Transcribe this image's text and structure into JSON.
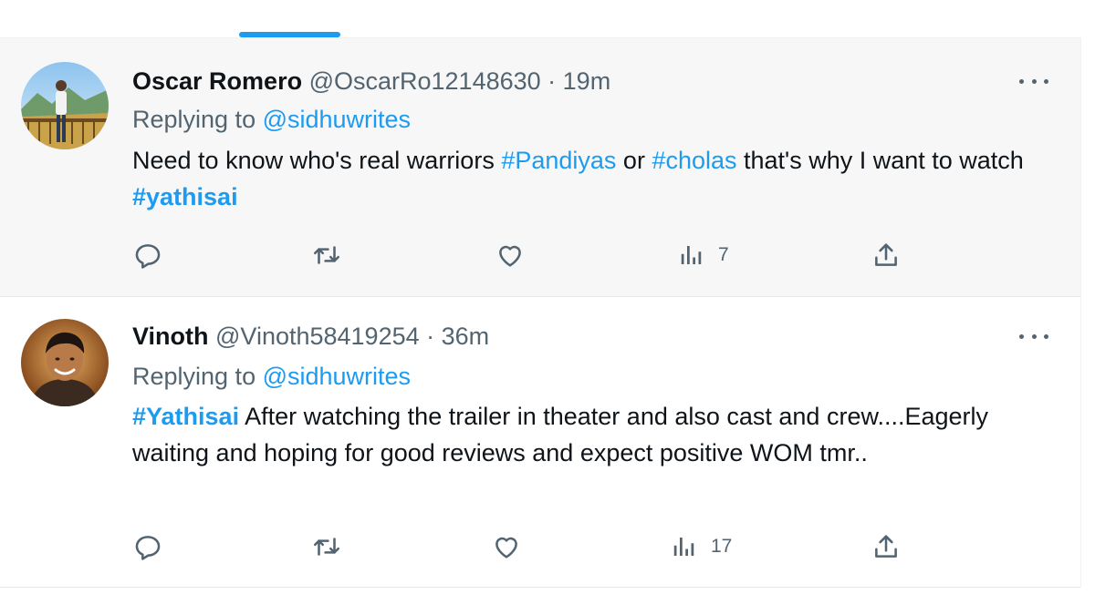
{
  "tweets": [
    {
      "author_name": "Oscar Romero",
      "handle": "@OscarRo12148630",
      "separator": " · ",
      "time": "19m",
      "replying_prefix": "Replying to ",
      "replying_to": "@sidhuwrites",
      "text_1": "Need to know who's real warriors ",
      "hashtag_1": "#Pandiyas",
      "text_2": " or ",
      "hashtag_2": "#cholas",
      "text_3": " that's why I want to watch ",
      "hashtag_3": "#yathisai",
      "views": "7",
      "avatar_icon": "person-at-railing-photo"
    },
    {
      "author_name": "Vinoth",
      "handle": "@Vinoth58419254",
      "separator": " · ",
      "time": "36m",
      "replying_prefix": "Replying to ",
      "replying_to": "@sidhuwrites",
      "hashtag_1": "#Yathisai",
      "text_1": " After watching the trailer in theater and also cast and crew....Eagerly waiting and hoping for good reviews and expect positive WOM tmr..",
      "views": "17",
      "avatar_icon": "smiling-man-portrait"
    }
  ],
  "icons": {
    "reply": "reply-icon",
    "retweet": "retweet-icon",
    "like": "like-icon",
    "views": "views-icon",
    "share": "share-icon",
    "more": "more-icon"
  },
  "colors": {
    "accent": "#1d9bf0",
    "muted": "#536471",
    "text": "#0f1419",
    "hover_bg": "#f7f7f7"
  }
}
